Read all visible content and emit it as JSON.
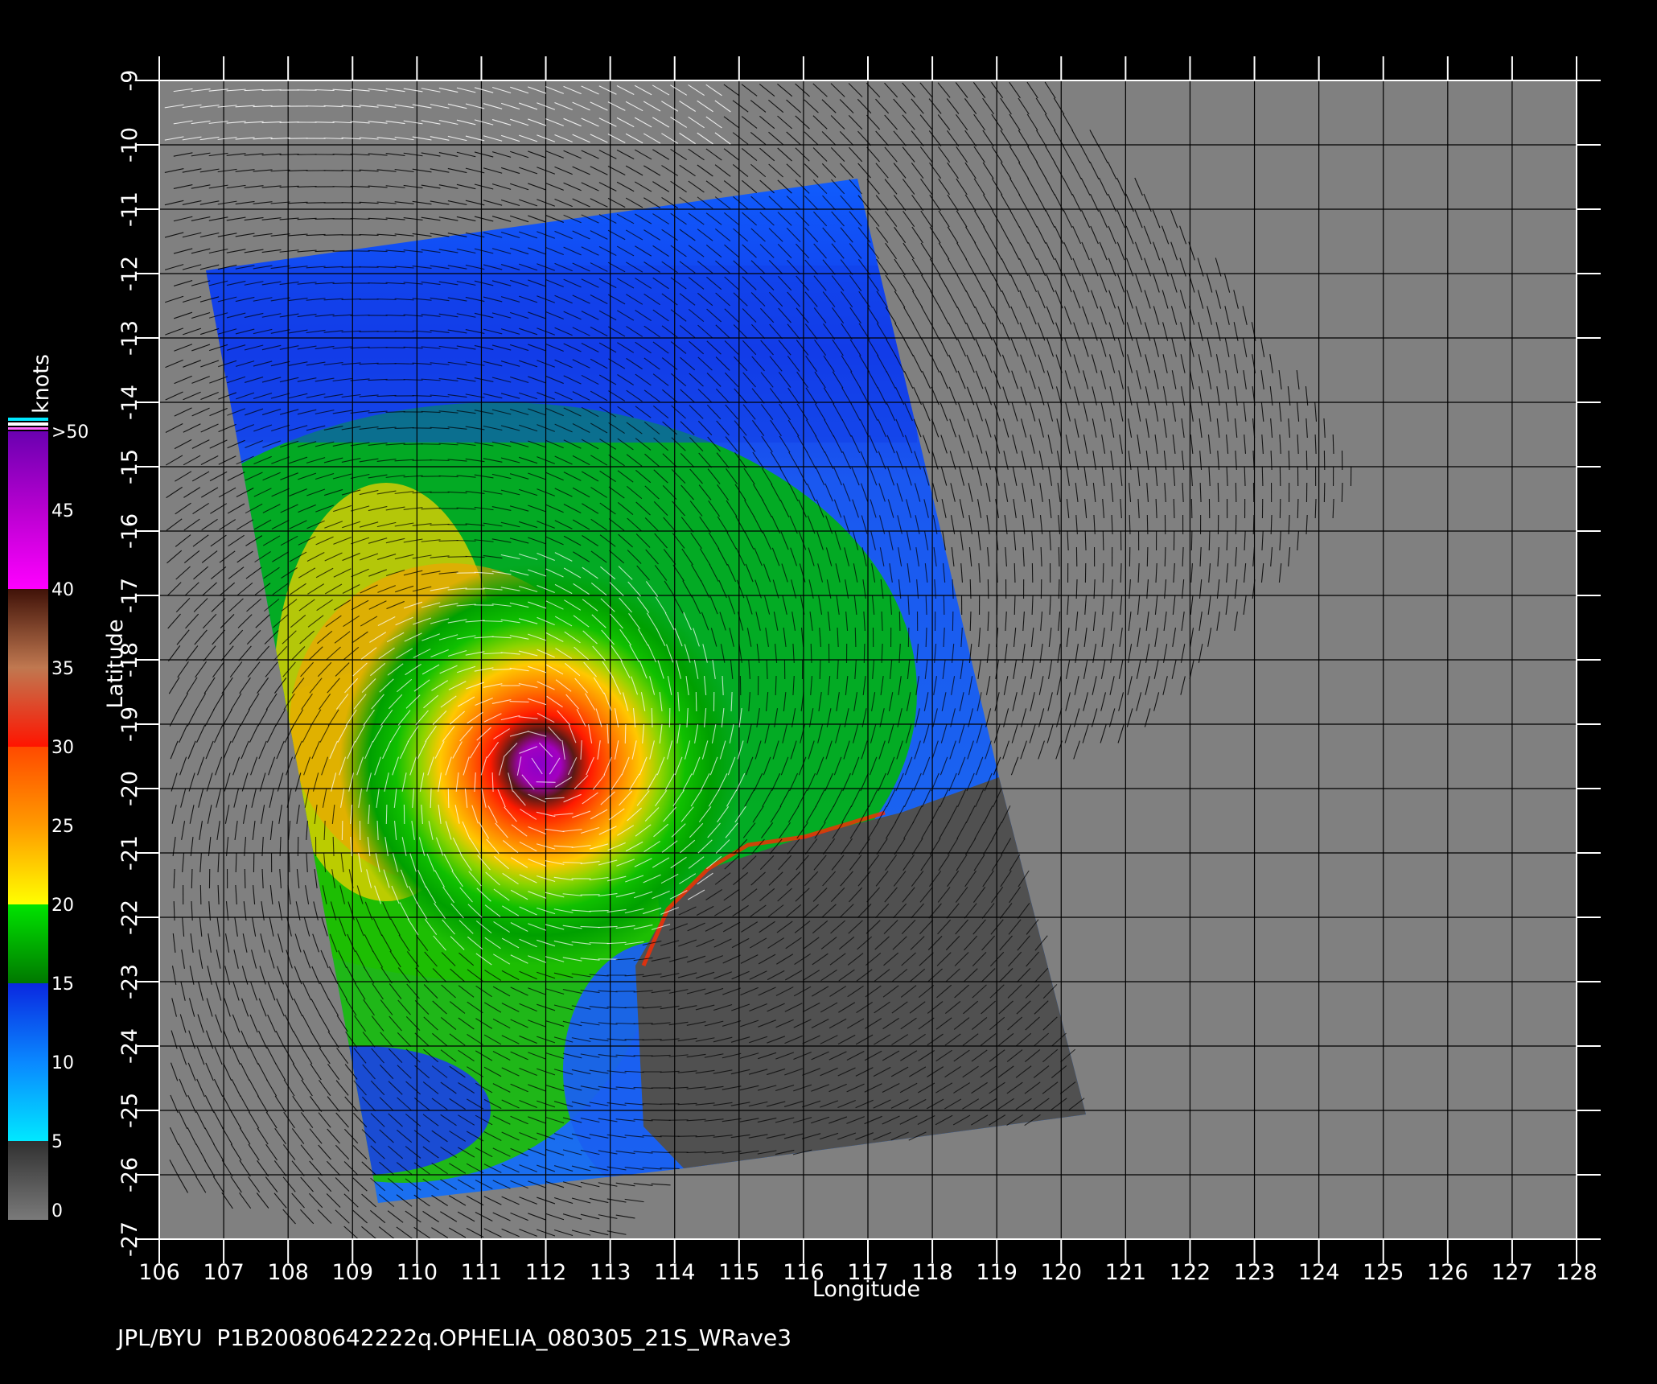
{
  "footer": {
    "producer": "JPL/BYU",
    "file_id": "P1B20080642222q.OPHELIA_080305_21S_WRave3"
  },
  "map": {
    "x_axis_label": "Longitude",
    "y_axis_label": "Latitude",
    "lon_range": [
      106,
      128
    ],
    "lat_range": [
      -27,
      -9
    ],
    "lon_ticks": [
      "106",
      "107",
      "108",
      "109",
      "110",
      "111",
      "112",
      "113",
      "114",
      "115",
      "116",
      "117",
      "118",
      "119",
      "120",
      "121",
      "122",
      "123",
      "124",
      "125",
      "126",
      "127",
      "128"
    ],
    "lat_ticks": [
      "-9",
      "-10",
      "-11",
      "-12",
      "-13",
      "-14",
      "-15",
      "-16",
      "-17",
      "-18",
      "-19",
      "-20",
      "-21",
      "-22",
      "-23",
      "-24",
      "-25",
      "-26",
      "-27"
    ],
    "background_color": "#808080",
    "land_mask_color": "#505050",
    "grid": true,
    "cyclone_center": {
      "lon": 111.9,
      "lat": -19.6
    }
  },
  "colorbar": {
    "unit_label": "knots",
    "tick_labels": [
      "0",
      "5",
      "10",
      "15",
      "20",
      "25",
      "30",
      "35",
      "40",
      "45",
      ">50"
    ],
    "stops": [
      {
        "value": 0,
        "color": "#7a7a7a"
      },
      {
        "value": 5,
        "color": "#303030"
      },
      {
        "value": 5,
        "color": "#00e8ff"
      },
      {
        "value": 10,
        "color": "#0a88ff"
      },
      {
        "value": 15,
        "color": "#0a28e0"
      },
      {
        "value": 15,
        "color": "#007800"
      },
      {
        "value": 20,
        "color": "#00e400"
      },
      {
        "value": 20,
        "color": "#ffff00"
      },
      {
        "value": 25,
        "color": "#ff9a00"
      },
      {
        "value": 30,
        "color": "#ff4a00"
      },
      {
        "value": 30,
        "color": "#ff1400"
      },
      {
        "value": 35,
        "color": "#c07850"
      },
      {
        "value": 40,
        "color": "#401208"
      },
      {
        "value": 40,
        "color": "#ff00ff"
      },
      {
        "value": 45,
        "color": "#b800d0"
      },
      {
        "value": 50,
        "color": "#6a00b0"
      }
    ]
  }
}
